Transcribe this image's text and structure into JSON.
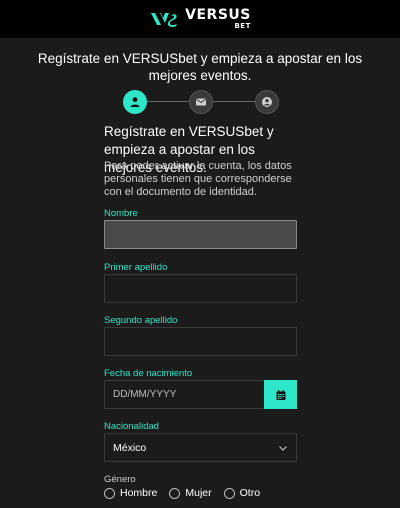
{
  "header": {
    "logo_main": "VERSUS",
    "logo_sub": "BET",
    "brand_color": "#2ee6c8"
  },
  "intro_text": "Regístrate en VERSUSbet y empieza a apostar en los mejores eventos.",
  "stepper": {
    "steps": [
      {
        "icon": "user-icon",
        "state": "active"
      },
      {
        "icon": "mail-icon",
        "state": "inactive"
      },
      {
        "icon": "profile-icon",
        "state": "inactive"
      }
    ]
  },
  "form": {
    "heading": "Regístrate en VERSUSbet y empieza a apostar en los mejores eventos.",
    "description": "Para poder activar la cuenta, los datos personales tienen que corresponderse con el documento de identidad.",
    "nombre_label": "Nombre",
    "primer_apellido_label": "Primer apellido",
    "segundo_apellido_label": "Segundo apellido",
    "fecha_label": "Fecha de nacimiento",
    "fecha_placeholder": "DD/MM/YYYY",
    "nacionalidad_label": "Nacionalidad",
    "nacionalidad_value": "México",
    "genero_label": "Género",
    "genero_options": [
      "Hombre",
      "Mujer",
      "Otro"
    ]
  }
}
